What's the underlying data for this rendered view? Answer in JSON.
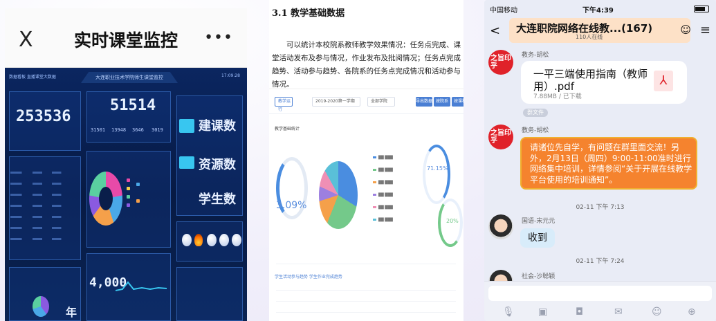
{
  "panel1": {
    "close_icon_text": "X",
    "title": "实时课堂监控",
    "more_icon_text": "•••",
    "dashboard": {
      "top_left_label": "数据看板  直播课堂大数据",
      "banner": "大连职业技术学院师生课堂监控",
      "clock": "17:09:28",
      "big_number_left": "253536",
      "big_number_center": "51514",
      "sub_numbers": [
        "31501",
        "13948",
        "3646",
        "3019"
      ],
      "big_text_right_1": "建课数",
      "big_text_right_2": "资源数",
      "big_text_right_3": "学生数",
      "year_label": "年",
      "bottom_number": "4,000"
    }
  },
  "panel2": {
    "heading": "3.1 教学基础数据",
    "paragraph": "可以统计本校院系教师教学效果情况：任务点完成、课堂活动发布及参与情况，作业发布及批阅情况；任务点完成趋势、活动参与趋势、各院系的任务点完成情况和活动参与情况。",
    "toolbar": {
      "tab_label": "教学运行",
      "term_select": "2019-2020第一学期",
      "college_select": "全部学院",
      "buttons": [
        "导出数据",
        "按院系",
        "按课程"
      ]
    },
    "section_label": "教学基础统计",
    "ring_percent_left": "3.09%",
    "ring_percent_right_1": "71.15%",
    "ring_percent_right_2": "20%",
    "bottom_section": "学生活动参与趋势    学生作业完成趋势",
    "colors": {
      "blue": "#4a8de0",
      "green": "#74c98a",
      "orange": "#f5a04a",
      "purple": "#9d7fe0",
      "pink": "#ef8fb5"
    }
  },
  "panel3": {
    "status": {
      "carrier": "中国移动",
      "time": "下午4:39"
    },
    "header": {
      "back_icon_text": "<",
      "title": "大连职院网络在线教...(167)",
      "online": "110人在线"
    },
    "messages": [
      {
        "sender": "教务-胡松",
        "avatar_text": "之旨印乎",
        "file_name": "一平三端使用指南（教师用）.pdf",
        "file_meta": "7.88MB / 已下载"
      },
      {
        "tag": "群文件"
      },
      {
        "sender": "教务-胡松",
        "avatar_text": "之旨印乎",
        "text": "请诸位先自学，有问题在群里面交流！另外，2月13日（周四）9:00-11:00准时进行网络集中培训，详情参阅“关于开展在线教学平台使用的培训通知”。"
      },
      {
        "timestamp": "02-11 下午 7:13"
      },
      {
        "sender": "国语-宋元元",
        "text": "收到"
      },
      {
        "timestamp": "02-11 下午 7:24"
      },
      {
        "sender": "社会-沙聪颖"
      }
    ]
  }
}
